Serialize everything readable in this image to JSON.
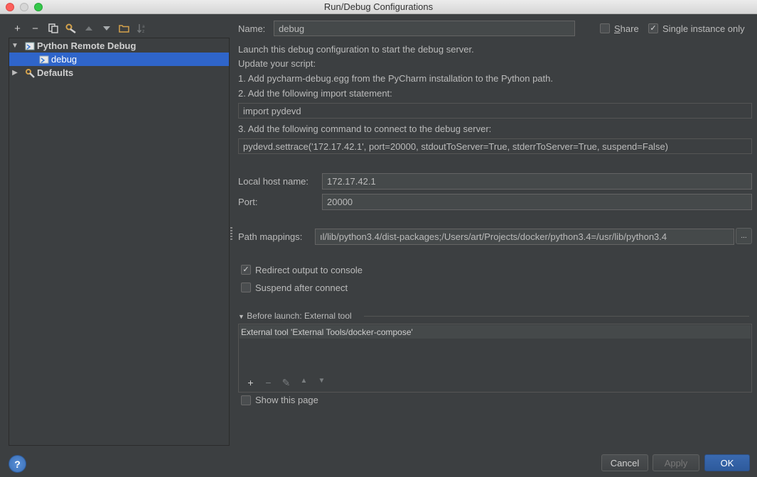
{
  "window": {
    "title": "Run/Debug Configurations"
  },
  "toolbar": {
    "icons": [
      "add-icon",
      "remove-icon",
      "copy-icon",
      "edit-defaults-icon",
      "move-up-icon",
      "move-down-icon",
      "folder-icon",
      "sort-icon"
    ],
    "glyphs": [
      "+",
      "−",
      "▯",
      "✎",
      "▲",
      "▼",
      "▭",
      "↓a"
    ]
  },
  "tree": {
    "group": "Python Remote Debug",
    "item": "debug",
    "defaults": "Defaults"
  },
  "form": {
    "name_label": "Name:",
    "name_value": "debug",
    "share_label": "Share",
    "single_instance_label": "Single instance only",
    "instructions": [
      "Launch this debug configuration to start the debug server.",
      "Update your script:",
      "1. Add pycharm-debug.egg from the PyCharm installation to the Python path.",
      "2. Add the following import statement:"
    ],
    "import_statement": "import pydevd",
    "step3": "3. Add the following command to connect to the debug server:",
    "settrace": "pydevd.settrace('172.17.42.1', port=20000, stdoutToServer=True, stderrToServer=True, suspend=False)",
    "host_label": "Local host name:",
    "host_value": "172.17.42.1",
    "port_label": "Port:",
    "port_value": "20000",
    "path_label": "Path mappings:",
    "path_value": "ıl/lib/python3.4/dist-packages;/Users/art/Projects/docker/python3.4=/usr/lib/python3.4",
    "path_button": "...",
    "redirect_label": "Redirect output to console",
    "redirect_checked": true,
    "suspend_label": "Suspend after connect",
    "suspend_checked": false,
    "before_launch_label": "Before launch: External tool",
    "external_tool_item": "External tool 'External Tools/docker-compose'",
    "show_page_label": "Show this page",
    "show_page_checked": false
  },
  "buttons": {
    "cancel": "Cancel",
    "apply": "Apply",
    "ok": "OK",
    "help": "?"
  }
}
